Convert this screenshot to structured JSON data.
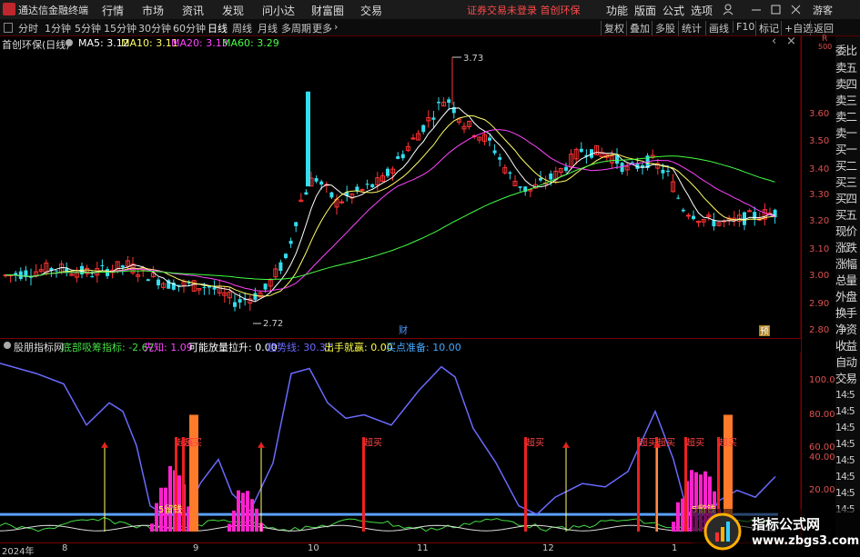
{
  "titlebar": {
    "app_name": "通达信金融终端",
    "menus": [
      "行情",
      "市场",
      "资讯",
      "发现",
      "问小达",
      "财富圈",
      "交易"
    ],
    "notice": "证券交易未登录  首创环保",
    "right_menus": [
      "功能",
      "版面",
      "公式",
      "选项"
    ],
    "guest": "游客"
  },
  "toolbar": {
    "periods": [
      "分时",
      "1分钟",
      "5分钟",
      "15分钟",
      "30分钟",
      "60分钟",
      "日线",
      "周线",
      "月线",
      "多周期",
      "更多"
    ],
    "active_period": "日线",
    "tools": [
      "复权",
      "叠加",
      "多股",
      "统计",
      "画线",
      "F10",
      "标记",
      "+自选",
      "返回"
    ]
  },
  "main_chart": {
    "stock_title": "首创环保(日线)",
    "indicators": [
      {
        "label": "MA5: 3.12",
        "color": "#ffffff"
      },
      {
        "label": "MA10: 3.11",
        "color": "#ffff66"
      },
      {
        "label": "MA20: 3.13",
        "color": "#ff44ff"
      },
      {
        "label": "MA60: 3.29",
        "color": "#44ff44"
      }
    ],
    "high_label": "3.73",
    "low_label": "2.72",
    "marker_cai": "财",
    "marker_yu": "预",
    "y_ticks": [
      "3.60",
      "3.50",
      "3.40",
      "3.30",
      "3.20",
      "3.10",
      "3.00",
      "2.90",
      "2.80"
    ],
    "top_right": "R",
    "top_right_sub": "500"
  },
  "sub_chart": {
    "name": "股朋指标网",
    "items": [
      {
        "label": "底部吸筹指标: -2.67",
        "color": "#44dd44"
      },
      {
        "label": "先知: 1.09",
        "color": "#ff44ff"
      },
      {
        "label": "可能放量拉升: 0.00",
        "color": "#ffffff"
      },
      {
        "label": "趋势线: 30.37",
        "color": "#6a6aff"
      },
      {
        "label": "出手就赢: 0.00",
        "color": "#ffff44"
      },
      {
        "label": "买点准备: 10.00",
        "color": "#44aaff"
      }
    ],
    "y_ticks": [
      "100.0",
      "80.00",
      "60.00",
      "40.00",
      "20.00"
    ],
    "buy_labels": [
      "超买",
      "超买",
      "超买",
      "超买",
      "超买",
      "超买",
      "超买",
      "超买"
    ],
    "fish_labels": [
      "5留钱",
      "5留钱"
    ]
  },
  "x_axis": [
    "2024年",
    "8",
    "9",
    "10",
    "11",
    "12",
    "1"
  ],
  "right_panel": [
    "委比",
    "卖五",
    "卖四",
    "卖三",
    "卖二",
    "卖一",
    "买一",
    "买二",
    "买三",
    "买四",
    "买五",
    "现价",
    "涨跌",
    "涨幅",
    "总量",
    "外盘",
    "换手",
    "净资",
    "收益",
    "自动",
    "交易"
  ],
  "right_ticks": [
    "14:5",
    "14:5",
    "14:5",
    "14:5",
    "14:5",
    "14:5",
    "14:5",
    "14:5"
  ],
  "watermark": {
    "line1": "指标公式网",
    "line2": "www.zbgs3.com"
  },
  "chart_data": {
    "type": "candlestick",
    "title": "首创环保(日线)",
    "ylim": [
      2.72,
      3.73
    ],
    "x": [
      "2024年",
      "8",
      "9",
      "10",
      "11",
      "12",
      "1"
    ],
    "series": [
      {
        "name": "MA5",
        "values": [
          3.12
        ]
      },
      {
        "name": "MA10",
        "values": [
          3.11
        ]
      },
      {
        "name": "MA20",
        "values": [
          3.13
        ]
      },
      {
        "name": "MA60",
        "values": [
          3.29
        ]
      }
    ]
  },
  "colors": {
    "up": "#ff3333",
    "down": "#33ddee",
    "ma5": "#ffffff",
    "ma10": "#ffff66",
    "ma20": "#ff44ff",
    "ma60": "#44ff44"
  }
}
